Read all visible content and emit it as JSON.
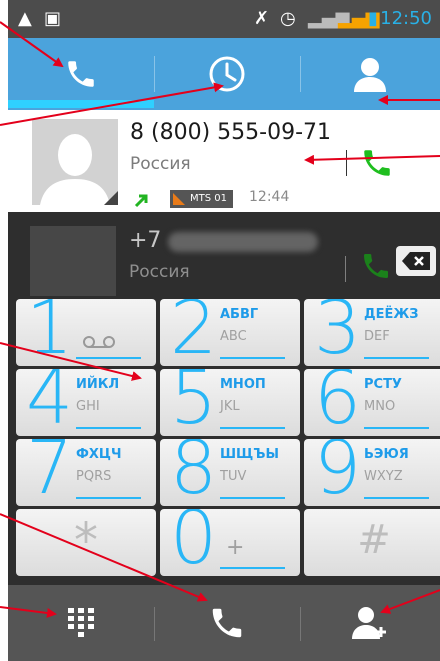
{
  "statusbar": {
    "time": "12:50"
  },
  "calllog": {
    "number": "8 (800) 555-09-71",
    "country": "Россия",
    "sim": "MTS 01",
    "time": "12:44"
  },
  "ghost": {
    "number": "+7",
    "country": "Россия"
  },
  "keys": [
    {
      "digit": "1",
      "cyr": "",
      "lat": ""
    },
    {
      "digit": "2",
      "cyr": "АБВГ",
      "lat": "ABC"
    },
    {
      "digit": "3",
      "cyr": "ДЕЁЖЗ",
      "lat": "DEF"
    },
    {
      "digit": "4",
      "cyr": "ИЙКЛ",
      "lat": "GHI"
    },
    {
      "digit": "5",
      "cyr": "МНОП",
      "lat": "JKL"
    },
    {
      "digit": "6",
      "cyr": "РСТУ",
      "lat": "MNO"
    },
    {
      "digit": "7",
      "cyr": "ФХЦЧ",
      "lat": "PQRS"
    },
    {
      "digit": "8",
      "cyr": "ШЩЪЫ",
      "lat": "TUV"
    },
    {
      "digit": "9",
      "cyr": "ЬЭЮЯ",
      "lat": "WXYZ"
    },
    {
      "digit": "*",
      "cyr": "",
      "lat": ""
    },
    {
      "digit": "0",
      "cyr": "",
      "lat": "+"
    },
    {
      "digit": "#",
      "cyr": "",
      "lat": ""
    }
  ],
  "colors": {
    "accent": "#29b6f6",
    "tabbar": "#4ba3dc",
    "call_green": "#1fbe1f",
    "annotation": "#e3001b"
  }
}
